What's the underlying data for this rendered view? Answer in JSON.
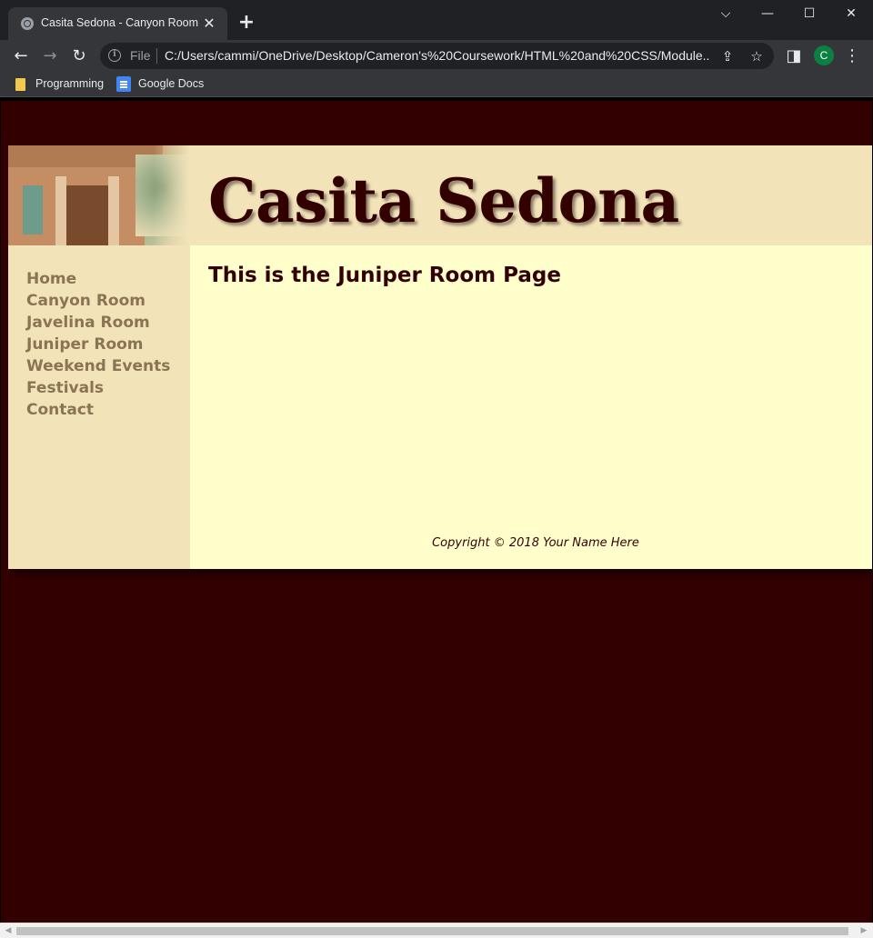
{
  "browser": {
    "tab_title": "Casita Sedona - Canyon Room",
    "tab_close": "✕",
    "new_tab": "+",
    "url_scheme_label": "File",
    "url": "C:/Users/cammi/OneDrive/Desktop/Cameron's%20Coursework/HTML%20and%20CSS/Module...",
    "profile_initial": "C",
    "bookmarks": [
      {
        "label": "Programming",
        "icon": "folder-icon"
      },
      {
        "label": "Google Docs",
        "icon": "google-docs-icon"
      }
    ],
    "window_controls": {
      "tab_search": "⌵",
      "minimize": "—",
      "maximize": "☐",
      "close": "✕"
    },
    "nav_icons": {
      "back": "←",
      "forward": "→",
      "reload": "↻",
      "share": "⇪",
      "star": "☆",
      "side_panel": "◨",
      "menu": "⋮"
    }
  },
  "page": {
    "site_title": "Casita Sedona",
    "heading": "This is the Juniper Room Page",
    "nav": [
      "Home",
      "Canyon Room",
      "Javelina Room",
      "Juniper Room",
      "Weekend Events",
      "Festivals",
      "Contact"
    ],
    "footer": "Copyright © 2018 Your Name Here"
  },
  "colors": {
    "page_background": "#330000",
    "header_background": "#f2e3b9",
    "main_background": "#ffffcc",
    "nav_link": "#8a7454",
    "text_dark": "#330000"
  }
}
